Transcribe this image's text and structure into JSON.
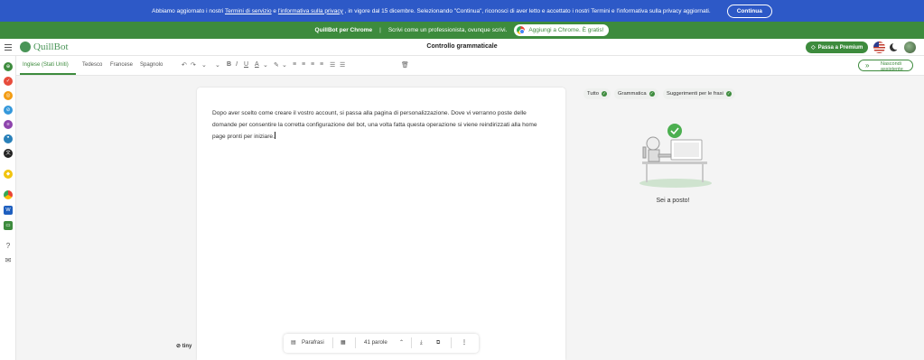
{
  "banner": {
    "text_before": "Abbiamo aggiornato i nostri ",
    "link1": "Termini di servizio",
    "text_mid": " e ",
    "link2": "l'informativa sulla privacy",
    "text_after": " , in vigore dal 15 dicembre. Selezionando \"Continua\", riconosci di aver letto e accettato i nostri Termini e l'informativa sulla privacy aggiornati.",
    "button": "Continua"
  },
  "promo": {
    "title": "QuillBot per Chrome",
    "separator": "|",
    "text": "Scrivi come un professionista, ovunque scrivi.",
    "button": "Aggiungi a Chrome. È gratis!"
  },
  "header": {
    "logo": "QuillBot",
    "title": "Controllo grammaticale",
    "premium": "Passa a Premium"
  },
  "toolbar": {
    "languages": [
      "Inglese (Stati Uniti)",
      "Tedesco",
      "Francese",
      "Spagnolo"
    ],
    "hide_assistant": "Nascondi assistente"
  },
  "editor": {
    "text": "Dopo aver scelto come creare il vostro account, si passa alla pagina di personalizzazione. Dove vi verranno poste delle domande per consentire la corretta configurazione del bot, una volta fatta questa operazione si viene reindirizzati alla home page pronti per iniziare.",
    "tiny_label": "tiny"
  },
  "bottom_bar": {
    "paraphrase": "Parafrasi",
    "word_count": "41 parole"
  },
  "right_panel": {
    "chips": [
      "Tutto",
      "Grammatica",
      "Suggerimenti per le frasi"
    ],
    "status": "Sei a posto!"
  },
  "colors": {
    "banner_blue": "#2d59c7",
    "brand_green": "#3d8b3d"
  }
}
